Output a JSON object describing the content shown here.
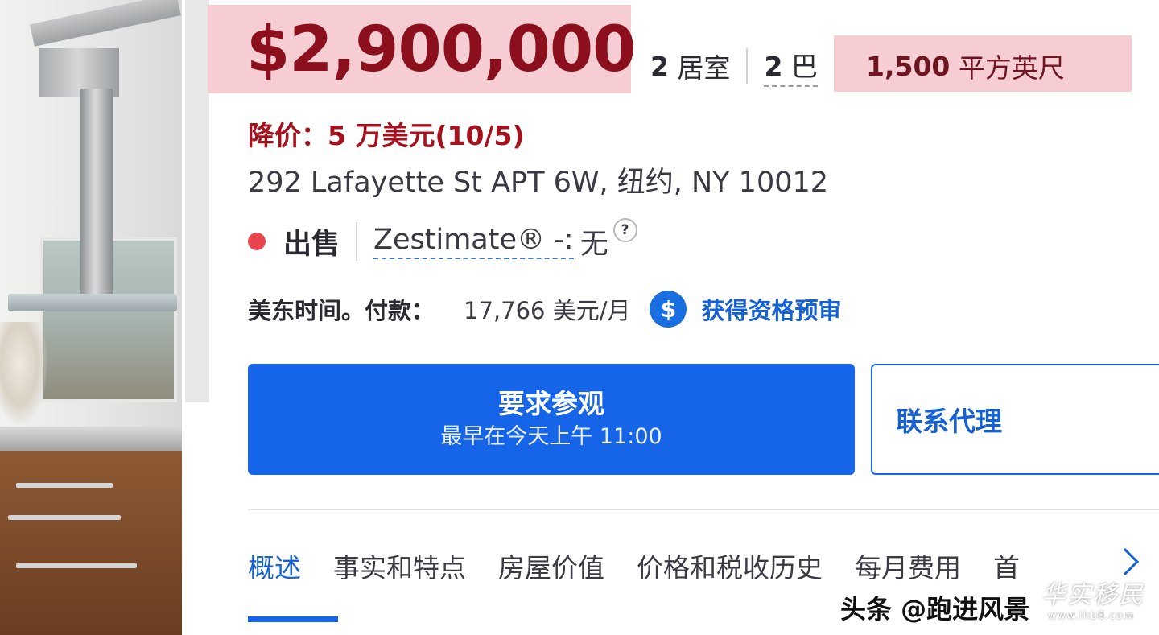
{
  "listing": {
    "price": "$2,900,000",
    "beds_num": "2",
    "beds_unit": "居室",
    "baths_num": "2",
    "baths_unit": "巴",
    "sqft_num": "1,500",
    "sqft_unit": "平方英尺",
    "price_cut": "降价：5 万美元(10/5)",
    "address": "292 Lafayette St APT 6W, 纽约, NY 10012",
    "status": "出售",
    "zestimate_label": "Zestimate® -:",
    "zestimate_value": "无",
    "zestimate_help": "?",
    "payment_label": "美东时间。付款：",
    "payment_value": "17,766 美元/月",
    "prequal_icon_glyph": "$",
    "prequal_link": "获得资格预审"
  },
  "actions": {
    "tour_title": "要求参观",
    "tour_subtitle": "最早在今天上午 11:00",
    "contact_agent": "联系代理"
  },
  "tabs": [
    {
      "label": "概述",
      "active": true
    },
    {
      "label": "事实和特点",
      "active": false
    },
    {
      "label": "房屋价值",
      "active": false
    },
    {
      "label": "价格和税收历史",
      "active": false
    },
    {
      "label": "每月费用",
      "active": false
    },
    {
      "label": "首",
      "active": false
    }
  ],
  "watermark": {
    "text": "头条 @跑进风景",
    "logo_text": "华实移民",
    "logo_url_text": "www.ihb8.com"
  },
  "colors": {
    "price": "#8b0f1d",
    "highlight": "#f5cdd3",
    "accent_blue": "#1665e8",
    "status_dot": "#e8454f"
  }
}
